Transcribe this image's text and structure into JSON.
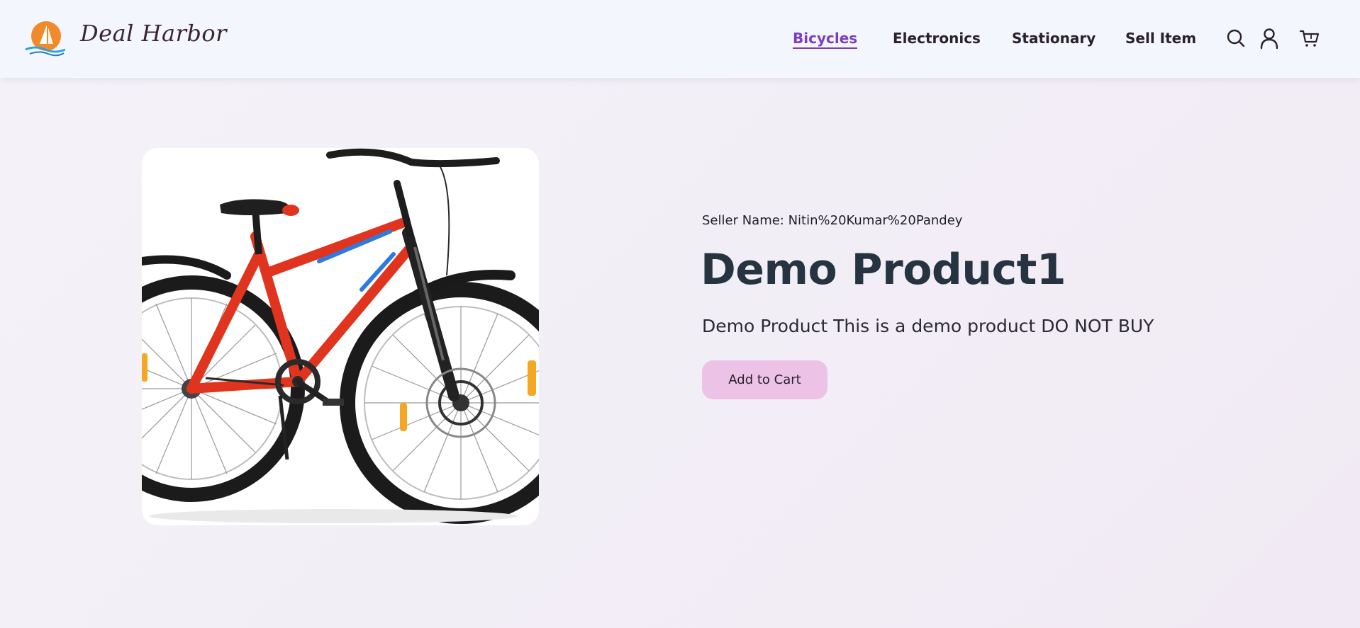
{
  "header": {
    "brand": "Deal Harbor",
    "nav": [
      {
        "label": "Bicycles",
        "active": true
      },
      {
        "label": "Electronics",
        "active": false
      },
      {
        "label": "Stationary",
        "active": false
      },
      {
        "label": "Sell Item",
        "active": false
      }
    ],
    "icons": [
      "search-icon",
      "user-icon",
      "cart-icon"
    ],
    "accent_color": "#7a3fc0"
  },
  "product": {
    "seller_line": "Seller Name: Nitin%20Kumar%20Pandey",
    "title": "Demo Product1",
    "description": "Demo Product This is a demo product DO NOT BUY",
    "add_to_cart_label": "Add to Cart",
    "image": "red-mountain-bicycle"
  }
}
